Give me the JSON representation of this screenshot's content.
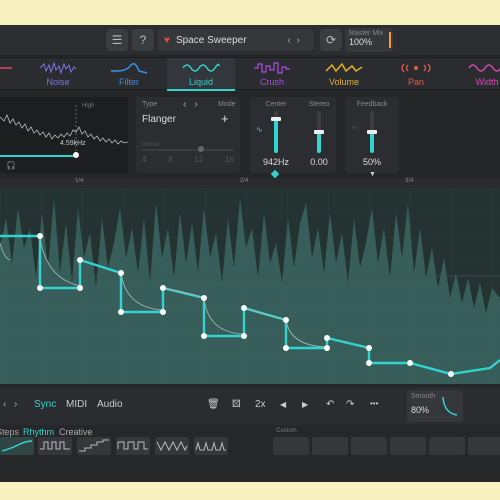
{
  "topbar": {
    "menu_icon": "hamburger-icon",
    "help_icon": "help-icon",
    "preset_name": "Space Sweeper",
    "preset_prev": "‹",
    "preset_next": "›",
    "refresh_icon": "refresh-icon",
    "master_mix_label": "Master Mix",
    "master_mix_value": "100%",
    "accent": "#f39a2b"
  },
  "tabs": [
    {
      "label": "",
      "color": "#e04a5a"
    },
    {
      "label": "Noise",
      "color": "#7a74e6"
    },
    {
      "label": "Filter",
      "color": "#3a8fe6"
    },
    {
      "label": "Liquid",
      "color": "#33d4d0",
      "active": true
    },
    {
      "label": "Crush",
      "color": "#b04ae6"
    },
    {
      "label": "Volume",
      "color": "#e6b020"
    },
    {
      "label": "Pan",
      "color": "#e65a4a"
    },
    {
      "label": "Width",
      "color": "#d44ab0"
    }
  ],
  "filter_panel": {
    "high_label": "High",
    "freq_value": "4.59kHz",
    "headphones_icon": "headphones-icon"
  },
  "type_panel": {
    "type_label": "Type",
    "mode_label": "Mode",
    "type_value": "Flanger",
    "mode_add": "+",
    "voices_label": "Voices",
    "voice_ticks": [
      "4",
      "8",
      "12",
      "16"
    ]
  },
  "knobs": {
    "center": {
      "label": "Center",
      "value": "942Hz",
      "level": 0.82
    },
    "stereo": {
      "label": "Stereo",
      "value": "0.00",
      "level": 0.5
    },
    "feedback": {
      "label": "Feedback",
      "value": "50%",
      "level": 0.5
    }
  },
  "ruler": [
    "1/4",
    "2/4",
    "3/4"
  ],
  "graph": {
    "accent": "#33d4d0"
  },
  "bottom_bar": {
    "prev": "‹",
    "next": "›",
    "sync": "Sync",
    "midi": "MIDI",
    "audio": "Audio",
    "rate": "2x",
    "more": "•••",
    "smooth_label": "Smooth",
    "smooth_value": "80%"
  },
  "shapes": {
    "categories": [
      "Steps",
      "Rhythm",
      "Creative"
    ],
    "custom_label": "Custom"
  }
}
